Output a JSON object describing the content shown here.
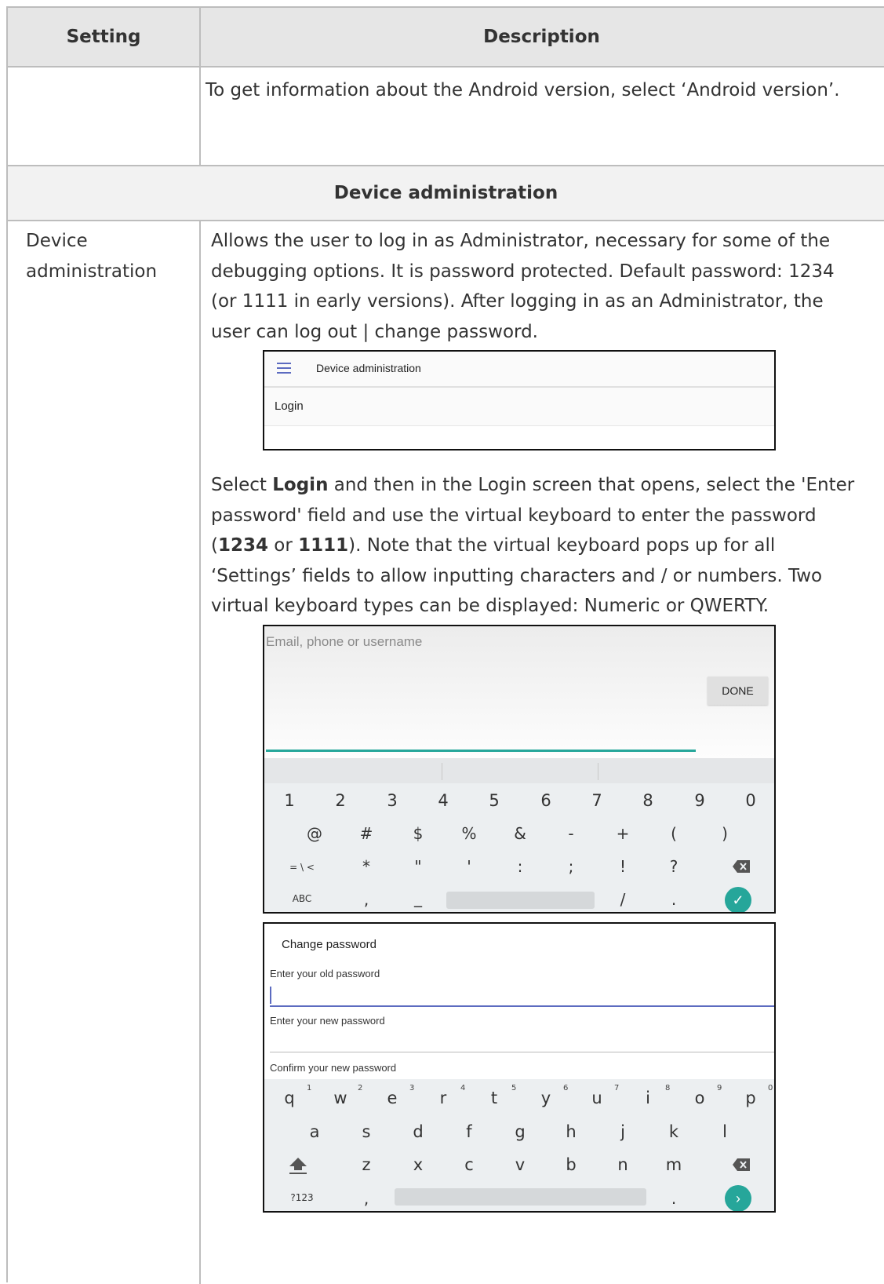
{
  "table": {
    "header_setting": "Setting",
    "header_description": "Description",
    "row0_description": "To get information about the Android version, select ‘Android version’.",
    "section_title": "Device administration",
    "row1_setting": [
      "Device",
      "administration"
    ],
    "row1_para1": [
      "Allows the user to log in as Administrator, necessary for some of the",
      "debugging options. It is password protected. Default password: 1234",
      "(or 1111 in early versions). After logging in as an Administrator, the",
      "user can log out | change password."
    ],
    "row1_para2": {
      "l1_a": "Select ",
      "l1_b": "Login",
      "l1_c": " and then in the Login screen that opens, select the 'Enter",
      "l2": "password' field and use the virtual keyboard to enter the password",
      "l3_a": "(",
      "l3_b": "1234",
      "l3_c": " or ",
      "l3_d": "1111",
      "l3_e": "). Note that the virtual keyboard pops up for all",
      "l4": "‘Settings’ fields to allow inputting characters and / or numbers. Two",
      "l5": "virtual keyboard types can be displayed: Numeric or QWERTY."
    }
  },
  "screenshot_device_admin": {
    "menu_icon": "hamburger-menu-icon",
    "title": "Device administration",
    "item": "Login",
    "accent_color": "#5c6bc0"
  },
  "screenshot_numeric_keyboard": {
    "placeholder": "Email, phone or username",
    "done_label": "DONE",
    "accent_color": "#26a69a",
    "row1": [
      "1",
      "2",
      "3",
      "4",
      "5",
      "6",
      "7",
      "8",
      "9",
      "0"
    ],
    "row2": [
      "@",
      "#",
      "$",
      "%",
      "&",
      "-",
      "+",
      "(",
      ")"
    ],
    "row3": [
      "= \\ <",
      "*",
      "\"",
      "'",
      ":",
      ";",
      "!",
      "?"
    ],
    "row4": [
      "ABC",
      ",",
      "_",
      "/",
      "."
    ],
    "backspace_icon": "backspace-icon",
    "enter_icon": "check-icon"
  },
  "screenshot_change_password": {
    "title": "Change password",
    "old_label": "Enter your old password",
    "new_label": "Enter your new password",
    "confirm_label": "Confirm your new password",
    "row1": [
      "q",
      "w",
      "e",
      "r",
      "t",
      "y",
      "u",
      "i",
      "o",
      "p"
    ],
    "row1_hints": [
      "1",
      "2",
      "3",
      "4",
      "5",
      "6",
      "7",
      "8",
      "9",
      "0"
    ],
    "row2": [
      "a",
      "s",
      "d",
      "f",
      "g",
      "h",
      "j",
      "k",
      "l"
    ],
    "row3": [
      "z",
      "x",
      "c",
      "v",
      "b",
      "n",
      "m"
    ],
    "row4": [
      "?123",
      ",",
      "."
    ],
    "shift_icon": "shift-icon",
    "backspace_icon": "backspace-icon",
    "enter_icon": "arrow-right-icon",
    "accent_color": "#26a69a"
  }
}
